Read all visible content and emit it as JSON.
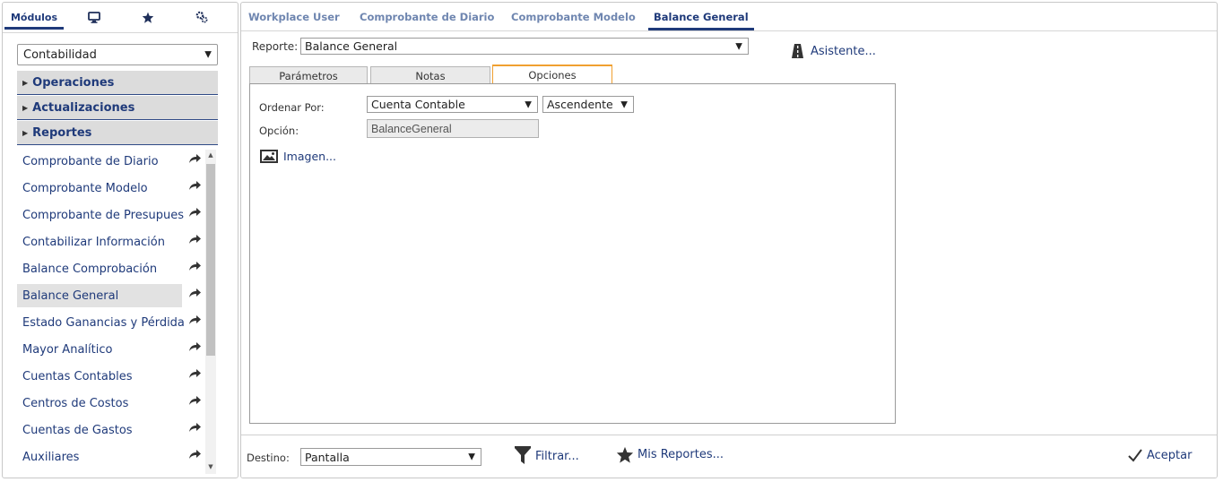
{
  "left_tabs": {
    "modulos_label": "Módulos",
    "monitor_icon": "monitor-icon",
    "favorites_icon": "star-icon",
    "settings_icon": "gear-icon"
  },
  "module_select": {
    "value": "Contabilidad"
  },
  "sections": [
    {
      "label": "Operaciones"
    },
    {
      "label": "Actualizaciones"
    },
    {
      "label": "Reportes"
    }
  ],
  "menu_items": [
    {
      "label": "Comprobante de Diario"
    },
    {
      "label": "Comprobante Modelo"
    },
    {
      "label": "Comprobante de Presupues"
    },
    {
      "label": "Contabilizar Información"
    },
    {
      "label": "Balance Comprobación"
    },
    {
      "label": "Balance General",
      "selected": true
    },
    {
      "label": "Estado Ganancias y Pérdida"
    },
    {
      "label": "Mayor Analítico"
    },
    {
      "label": "Cuentas Contables"
    },
    {
      "label": "Centros de Costos"
    },
    {
      "label": "Cuentas de Gastos"
    },
    {
      "label": "Auxiliares"
    }
  ],
  "top_tabs": [
    {
      "label": "Workplace User"
    },
    {
      "label": "Comprobante de Diario"
    },
    {
      "label": "Comprobante Modelo"
    },
    {
      "label": "Balance General",
      "active": true
    }
  ],
  "reporte": {
    "label": "Reporte:",
    "value": "Balance General",
    "asistente_label": "Asistente..."
  },
  "option_tabs": [
    {
      "label": "Parámetros"
    },
    {
      "label": "Notas"
    },
    {
      "label": "Opciones",
      "active": true
    }
  ],
  "options": {
    "ordenar_label": "Ordenar Por:",
    "ordenar_value": "Cuenta Contable",
    "orden_value": "Ascendente",
    "opcion_label": "Opción:",
    "opcion_value": "BalanceGeneral",
    "imagen_label": "Imagen..."
  },
  "bottom_bar": {
    "destino_label": "Destino:",
    "destino_value": "Pantalla",
    "filtrar_label": "Filtrar...",
    "mis_reportes_label": "Mis Reportes...",
    "aceptar_label": "Aceptar"
  },
  "colors": {
    "accent": "#1f3a7a",
    "inactive_tab": "#6f86b0",
    "active_option_tab": "#f0a030",
    "section_bg": "#dcdcdc"
  }
}
